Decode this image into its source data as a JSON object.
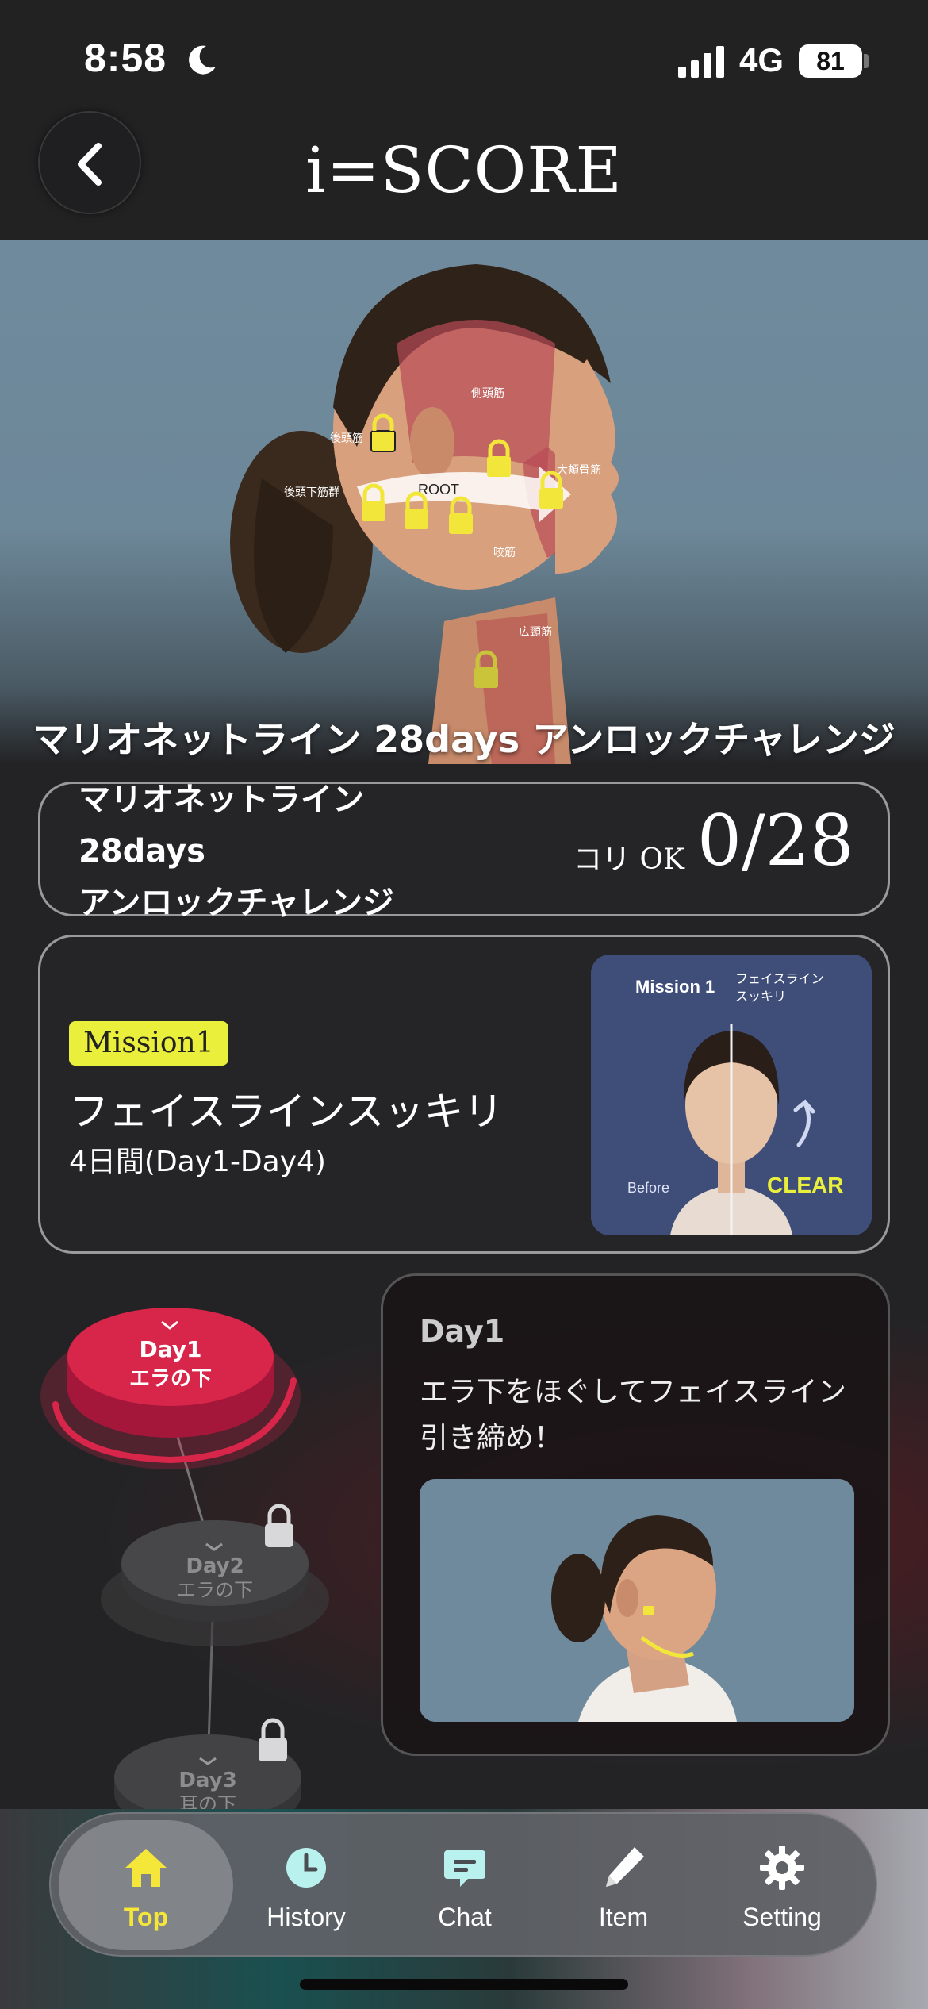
{
  "status_bar": {
    "time": "8:58",
    "network": "4G",
    "battery": "81"
  },
  "header": {
    "title": "i=SCORE"
  },
  "hero": {
    "muscle_labels": [
      "側頭筋",
      "後頭筋",
      "後頭下筋群",
      "大頬骨筋",
      "咬筋",
      "広頸筋"
    ],
    "root_label": "ROOT"
  },
  "challenge": {
    "title": "マリオネットライン 28days アンロックチャレンジ",
    "progress_name_lines": [
      "マリオネットライン",
      "28days",
      "アンロックチャレンジ"
    ],
    "progress_label": "コリ OK",
    "progress_count": "0/28"
  },
  "mission": {
    "badge": "Mission1",
    "title": "フェイスラインスッキリ",
    "duration": "4日間(Day1-Day4)",
    "image": {
      "heading": "Mission 1",
      "subheading_lines": [
        "フェイスライン",
        "スッキリ"
      ],
      "before_label": "Before",
      "clear_label": "CLEAR"
    }
  },
  "days": [
    {
      "day": "Day1",
      "area": "エラの下",
      "locked": false,
      "active": true
    },
    {
      "day": "Day2",
      "area": "エラの下",
      "locked": true,
      "active": false
    },
    {
      "day": "Day3",
      "area": "耳の下",
      "locked": true,
      "active": false
    }
  ],
  "day_card": {
    "day": "Day1",
    "description": "エラ下をほぐしてフェイスライン引き締め！"
  },
  "tabs": [
    {
      "label": "Top",
      "icon": "home-icon",
      "active": true
    },
    {
      "label": "History",
      "icon": "clock-icon",
      "active": false
    },
    {
      "label": "Chat",
      "icon": "chat-icon",
      "active": false
    },
    {
      "label": "Item",
      "icon": "pen-icon",
      "active": false
    },
    {
      "label": "Setting",
      "icon": "gear-icon",
      "active": false
    }
  ],
  "colors": {
    "accent_yellow": "#f5e63a",
    "badge_yellow": "#e9ef3b",
    "active_day_red": "#d8254a"
  }
}
